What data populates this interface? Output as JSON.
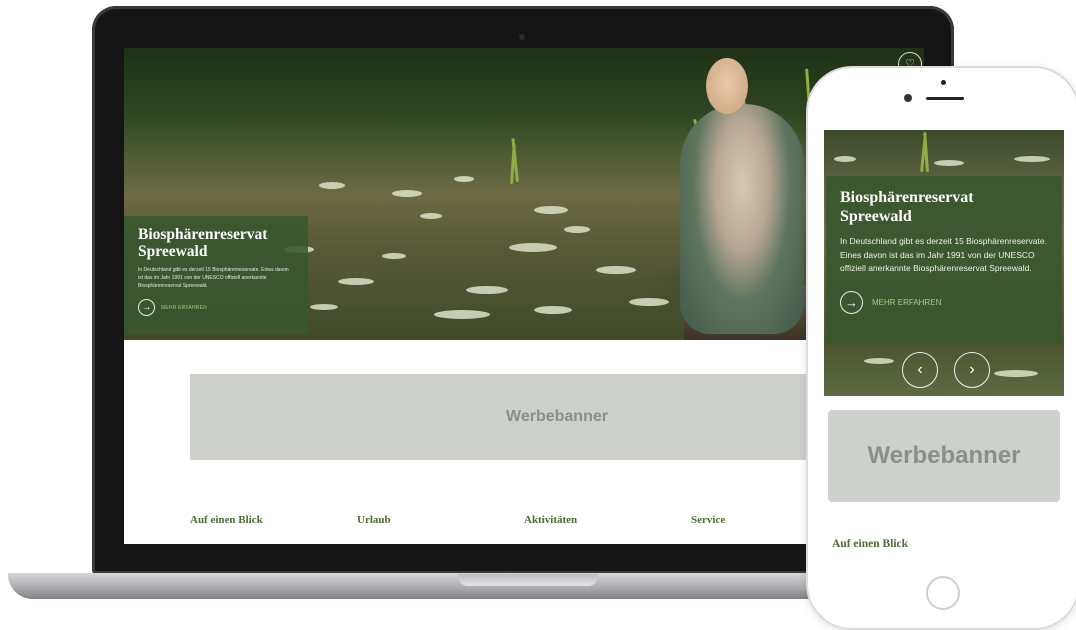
{
  "hero": {
    "title_line1": "Biosphärenreservat",
    "title_line2": "Spreewald",
    "text": "In Deutschland gibt es derzeit 15 Biosphärenreservate. Eines davon ist das im Jahr 1991 von der UNESCO offiziell anerkannte Biosphärenreservat Spreewald.",
    "more_label": "MEHR ERFAHREN"
  },
  "banner": {
    "label": "Werbebanner"
  },
  "nav": {
    "items": [
      "Auf einen Blick",
      "Urlaub",
      "Aktivitäten",
      "Service"
    ]
  },
  "icons": {
    "more": "arrow-right-circle-icon",
    "prev": "chevron-left-icon",
    "next": "chevron-right-icon",
    "favorite": "heart-icon"
  },
  "colors": {
    "brand_green": "#37562e",
    "link_green": "#4d6b32",
    "banner_gray": "#cdd0cb",
    "accent_light_green": "#a9c98a"
  }
}
